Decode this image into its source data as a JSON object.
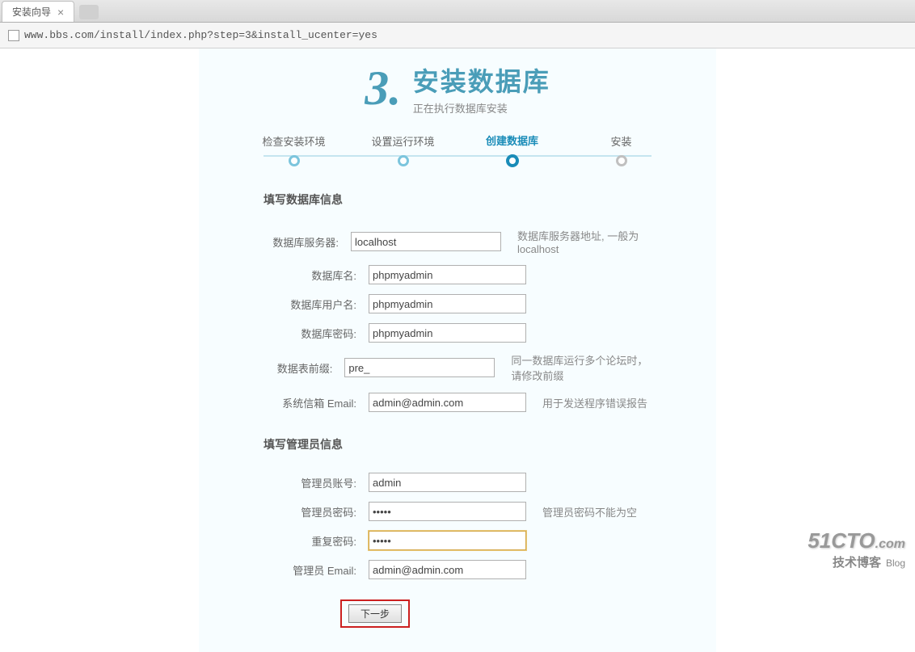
{
  "browser": {
    "tab_title": "安装向导",
    "url": "www.bbs.com/install/index.php?step=3&install_ucenter=yes"
  },
  "header": {
    "step_number": "3.",
    "title": "安装数据库",
    "subtitle": "正在执行数据库安装"
  },
  "progress": [
    {
      "label": "检查安装环境",
      "state": "done"
    },
    {
      "label": "设置运行环境",
      "state": "done"
    },
    {
      "label": "创建数据库",
      "state": "active"
    },
    {
      "label": "安装",
      "state": "pending"
    }
  ],
  "sections": {
    "db": {
      "title": "填写数据库信息",
      "fields": [
        {
          "label": "数据库服务器:",
          "value": "localhost",
          "hint": "数据库服务器地址, 一般为 localhost",
          "type": "text"
        },
        {
          "label": "数据库名:",
          "value": "phpmyadmin",
          "hint": "",
          "type": "text"
        },
        {
          "label": "数据库用户名:",
          "value": "phpmyadmin",
          "hint": "",
          "type": "text"
        },
        {
          "label": "数据库密码:",
          "value": "phpmyadmin",
          "hint": "",
          "type": "text"
        },
        {
          "label": "数据表前缀:",
          "value": "pre_",
          "hint": "同一数据库运行多个论坛时，请修改前缀",
          "type": "text"
        },
        {
          "label": "系统信箱 Email:",
          "value": "admin@admin.com",
          "hint": "用于发送程序错误报告",
          "type": "text"
        }
      ]
    },
    "admin": {
      "title": "填写管理员信息",
      "fields": [
        {
          "label": "管理员账号:",
          "value": "admin",
          "hint": "",
          "type": "text"
        },
        {
          "label": "管理员密码:",
          "value": "•••••",
          "hint": "管理员密码不能为空",
          "type": "password"
        },
        {
          "label": "重复密码:",
          "value": "•••••",
          "hint": "",
          "type": "password",
          "focused": true
        },
        {
          "label": "管理员 Email:",
          "value": "admin@admin.com",
          "hint": "",
          "type": "text"
        }
      ]
    }
  },
  "submit_label": "下一步",
  "watermark": {
    "main": "51CTO",
    "suffix": ".com",
    "sub": "技术博客",
    "blog": "Blog"
  }
}
